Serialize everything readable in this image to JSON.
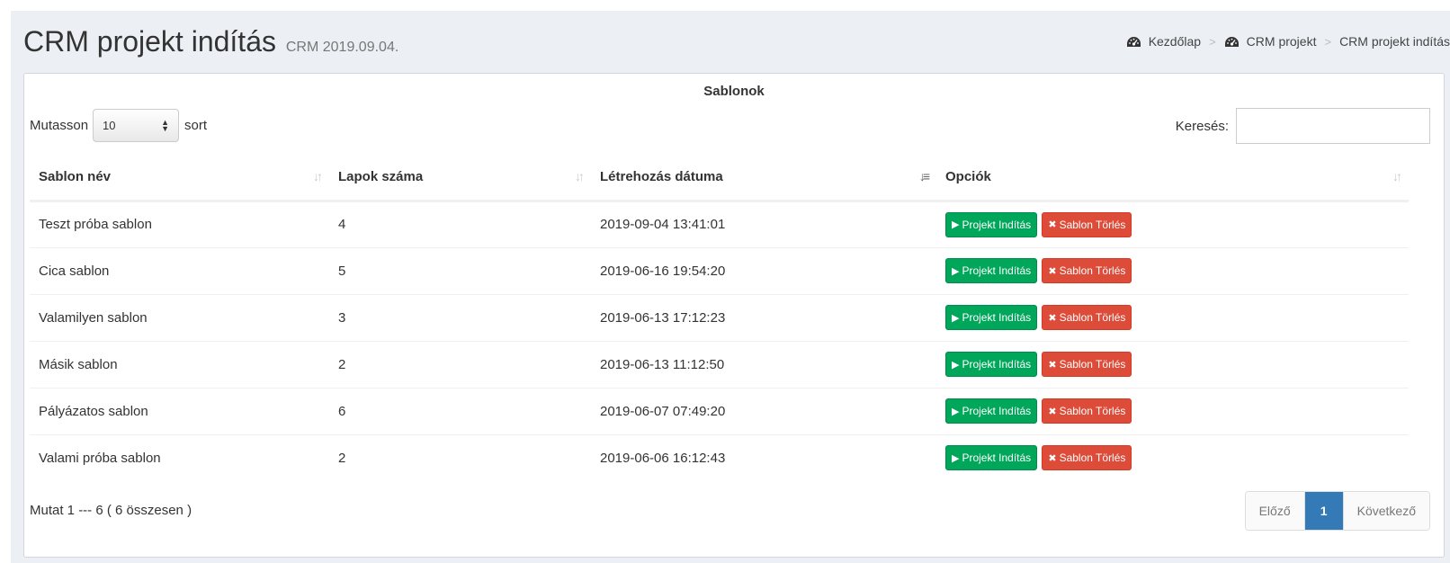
{
  "header": {
    "title": "CRM projekt indítás",
    "subtitle": "CRM 2019.09.04.",
    "breadcrumb": [
      {
        "label": "Kezdőlap",
        "icon": "dashboard-icon"
      },
      {
        "label": "CRM projekt",
        "icon": "dashboard-icon"
      },
      {
        "label": "CRM projekt indítás"
      }
    ]
  },
  "box": {
    "title": "Sablonok",
    "length_prefix": "Mutasson",
    "length_value": "10",
    "length_suffix": "sort",
    "search_label": "Keresés:",
    "search_value": "",
    "search_placeholder": ""
  },
  "table": {
    "columns": [
      "Sablon név",
      "Lapok száma",
      "Létrehozás dátuma",
      "Opciók"
    ],
    "rows": [
      {
        "name": "Teszt próba sablon",
        "pages": "4",
        "created": "2019-09-04 13:41:01"
      },
      {
        "name": "Cica sablon",
        "pages": "5",
        "created": "2019-06-16 19:54:20"
      },
      {
        "name": "Valamilyen sablon",
        "pages": "3",
        "created": "2019-06-13 17:12:23"
      },
      {
        "name": "Másik sablon",
        "pages": "2",
        "created": "2019-06-13 11:12:50"
      },
      {
        "name": "Pályázatos sablon",
        "pages": "6",
        "created": "2019-06-07 07:49:20"
      },
      {
        "name": "Valami próba sablon",
        "pages": "2",
        "created": "2019-06-06 16:12:43"
      }
    ],
    "start_label": "Projekt Indítás",
    "delete_label": "Sablon Törlés"
  },
  "footer": {
    "info": "Mutat 1 --- 6 ( 6 összesen )",
    "prev": "Előző",
    "page": "1",
    "next": "Következő"
  },
  "colors": {
    "success": "#00a65a",
    "danger": "#dd4b39",
    "primary": "#337ab7",
    "background": "#ecf0f5"
  }
}
